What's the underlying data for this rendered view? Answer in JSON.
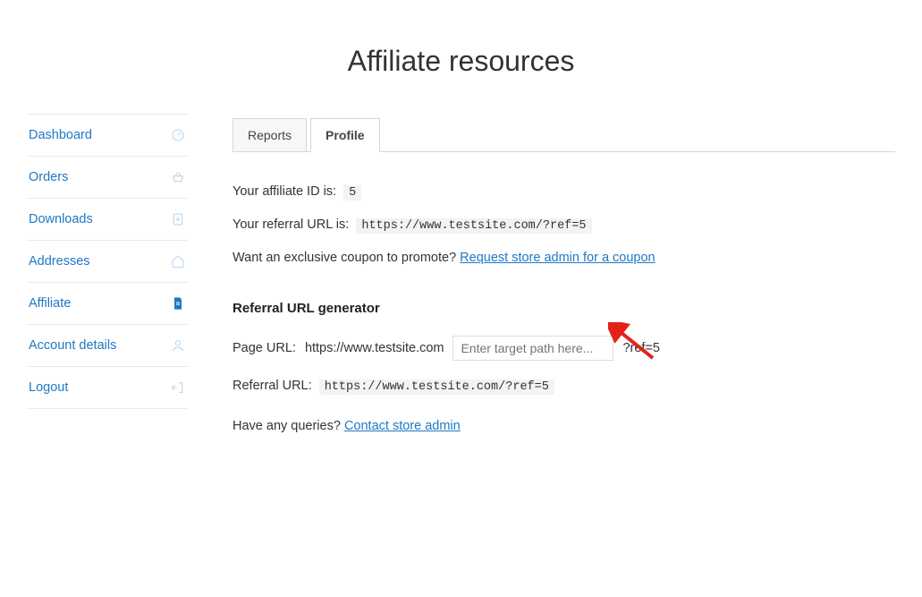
{
  "page_title": "Affiliate resources",
  "sidebar": {
    "items": [
      {
        "label": "Dashboard",
        "icon": "dashboard"
      },
      {
        "label": "Orders",
        "icon": "basket"
      },
      {
        "label": "Downloads",
        "icon": "download"
      },
      {
        "label": "Addresses",
        "icon": "home"
      },
      {
        "label": "Affiliate",
        "icon": "file",
        "active": true
      },
      {
        "label": "Account details",
        "icon": "user"
      },
      {
        "label": "Logout",
        "icon": "logout"
      }
    ]
  },
  "tabs": {
    "items": [
      {
        "label": "Reports",
        "active": false
      },
      {
        "label": "Profile",
        "active": true
      }
    ]
  },
  "profile": {
    "affiliate_id_label": "Your affiliate ID is:",
    "affiliate_id": "5",
    "referral_url_label": "Your referral URL is:",
    "referral_url": "https://www.testsite.com/?ref=5",
    "coupon_prompt": "Want an exclusive coupon to promote?",
    "coupon_link": "Request store admin for a coupon",
    "generator": {
      "title": "Referral URL generator",
      "page_url_label": "Page URL:",
      "page_url_base": "https://www.testsite.com",
      "target_placeholder": "Enter target path here...",
      "ref_suffix": "?ref=5",
      "referral_url_label": "Referral URL:",
      "referral_url_value": "https://www.testsite.com/?ref=5"
    },
    "queries_prompt": "Have any queries?",
    "queries_link": "Contact store admin"
  }
}
